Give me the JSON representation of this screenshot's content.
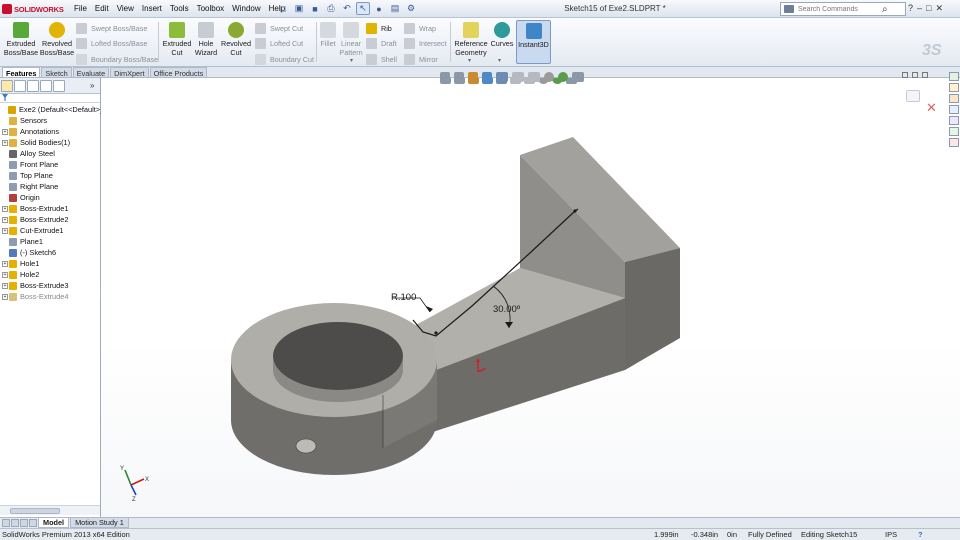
{
  "app": {
    "logo_text": "SOLIDWORKS",
    "document_title": "Sketch15 of Exe2.SLDPRT *"
  },
  "menu": [
    "File",
    "Edit",
    "View",
    "Insert",
    "Tools",
    "Toolbox",
    "Window",
    "Help"
  ],
  "search": {
    "placeholder": "Search Commands"
  },
  "command_manager": {
    "extruded_boss": "Extruded\nBoss/Base",
    "revolved_boss": "Revolved\nBoss/Base",
    "swept_boss": "Swept Boss/Base",
    "lofted_boss": "Lofted Boss/Base",
    "boundary_boss": "Boundary Boss/Base",
    "extruded_cut": "Extruded\nCut",
    "hole_wizard": "Hole\nWizard",
    "revolved_cut": "Revolved\nCut",
    "swept_cut": "Swept Cut",
    "lofted_cut": "Lofted Cut",
    "boundary_cut": "Boundary Cut",
    "fillet": "Fillet",
    "linear_pattern": "Linear\nPattern",
    "rib": "Rib",
    "draft": "Draft",
    "shell": "Shell",
    "wrap": "Wrap",
    "intersect": "Intersect",
    "mirror": "Mirror",
    "reference_geometry": "Reference\nGeometry",
    "curves": "Curves",
    "instant3d": "Instant3D"
  },
  "command_tabs": [
    "Features",
    "Sketch",
    "Evaluate",
    "DimXpert",
    "Office Products"
  ],
  "feature_tree": [
    {
      "label": "Exe2  (Default<<Default>_",
      "expander": "none",
      "level": 0,
      "icon_color": "#d9a500"
    },
    {
      "label": "Sensors",
      "expander": "none",
      "level": 1,
      "icon_color": "#e0b040"
    },
    {
      "label": "Annotations",
      "expander": "+",
      "level": 1,
      "icon_color": "#e0b040"
    },
    {
      "label": "Solid Bodies(1)",
      "expander": "+",
      "level": 1,
      "icon_color": "#e0b040"
    },
    {
      "label": "Alloy Steel",
      "expander": "none",
      "level": 1,
      "icon_color": "#666666"
    },
    {
      "label": "Front Plane",
      "expander": "none",
      "level": 1,
      "icon_color": "#8f9bb0"
    },
    {
      "label": "Top Plane",
      "expander": "none",
      "level": 1,
      "icon_color": "#8f9bb0"
    },
    {
      "label": "Right Plane",
      "expander": "none",
      "level": 1,
      "icon_color": "#8f9bb0"
    },
    {
      "label": "Origin",
      "expander": "none",
      "level": 1,
      "icon_color": "#b04040"
    },
    {
      "label": "Boss-Extrude1",
      "expander": "+",
      "level": 1,
      "icon_color": "#e5b000"
    },
    {
      "label": "Boss-Extrude2",
      "expander": "+",
      "level": 1,
      "icon_color": "#e5b000"
    },
    {
      "label": "Cut-Extrude1",
      "expander": "+",
      "level": 1,
      "icon_color": "#e5b000"
    },
    {
      "label": "Plane1",
      "expander": "none",
      "level": 1,
      "icon_color": "#8f9bb0"
    },
    {
      "label": "(-) Sketch6",
      "expander": "none",
      "level": 1,
      "icon_color": "#5577bb"
    },
    {
      "label": "Hole1",
      "expander": "+",
      "level": 1,
      "icon_color": "#e5b000"
    },
    {
      "label": "Hole2",
      "expander": "+",
      "level": 1,
      "icon_color": "#e5b000"
    },
    {
      "label": "Boss-Extrude3",
      "expander": "+",
      "level": 1,
      "icon_color": "#e5b000"
    },
    {
      "label": "Boss-Extrude4",
      "expander": "+",
      "level": 1,
      "icon_color": "#d6c37a",
      "dimmed": true
    }
  ],
  "viewport": {
    "dimension_radius": "R.100",
    "dimension_angle": "30.00º",
    "triad_x": "X",
    "triad_y": "Y",
    "triad_z": "Z"
  },
  "bottom_tabs": [
    "Model",
    "Motion Study 1"
  ],
  "status": {
    "edition": "SolidWorks Premium 2013 x64 Edition",
    "x": "1.999in",
    "y": "-0.348in",
    "z": "0in",
    "state": "Fully Defined",
    "editing": "Editing Sketch15",
    "units": "IPS",
    "help": "?"
  },
  "colors": {
    "face_light": "#b2b0ab",
    "face_mid": "#8e8d8a",
    "face_dark": "#676663",
    "sketch_line": "#1a1a1a",
    "origin": "#d02020",
    "accent_red": "#c8102e"
  }
}
